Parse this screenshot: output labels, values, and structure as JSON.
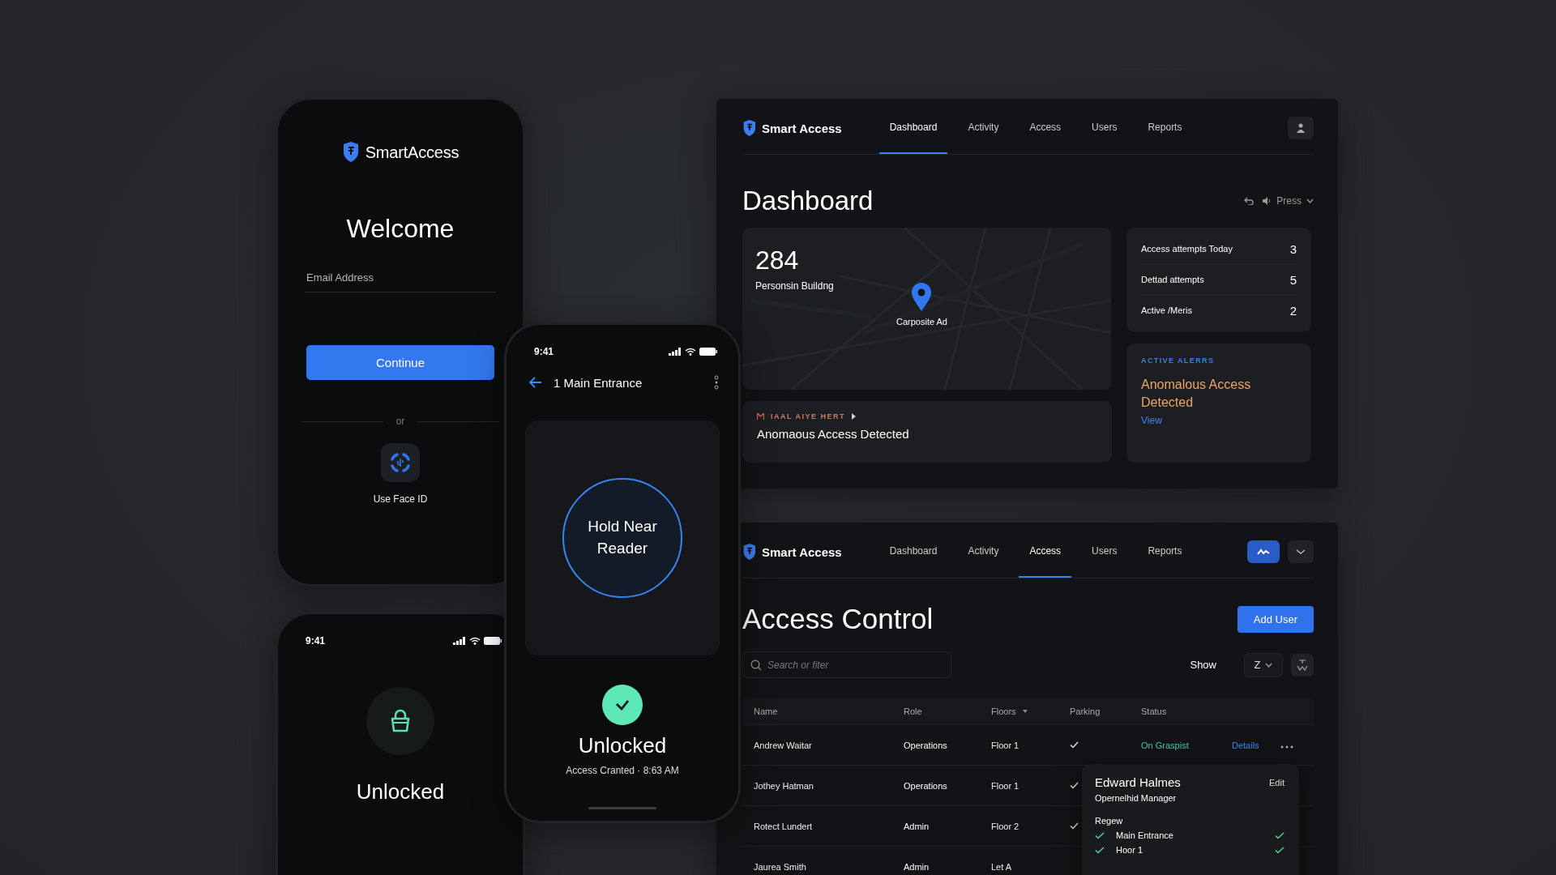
{
  "login_phone": {
    "brand": "SmartAccess",
    "title": "Welcome",
    "email": {
      "placeholder": "Email Address"
    },
    "continue_button": "Continue",
    "divider": "or",
    "face_id": "Use Face ID"
  },
  "reader_phone": {
    "status_bar": {
      "time": "9:41"
    },
    "title": "1 Main Entrance",
    "reader_prompt": "Hold Near Reader",
    "result": {
      "title": "Unlocked",
      "detail": "Access Cranted · 8:63 AM"
    }
  },
  "unlocked_phone": {
    "status_bar": {
      "time": "9:41"
    },
    "title": "Unlocked"
  },
  "dashboard": {
    "brand": "Smart Access",
    "tabs": [
      {
        "label": "Dashboard",
        "selected": true
      },
      {
        "label": "Activity",
        "selected": false
      },
      {
        "label": "Access",
        "selected": false
      },
      {
        "label": "Users",
        "selected": false
      },
      {
        "label": "Reports",
        "selected": false
      }
    ],
    "title": "Dashboard",
    "filter": "Press",
    "count": "284",
    "count_label": "Personsin Buildng",
    "map_pin_label": "Carposite Ad",
    "alert_banner": {
      "label": "IAAL AIYE HERT",
      "message": "Anomaous Access Detected"
    },
    "stats": [
      {
        "label": "Access attempts Today",
        "value": "3"
      },
      {
        "label": "Dettad attempts",
        "value": "5"
      },
      {
        "label": "Active /Meris",
        "value": "2"
      }
    ],
    "active_alerts": {
      "heading": "ACTIVE ALERRS",
      "message": "Anomalous Access Detected",
      "link": "View"
    }
  },
  "access_control": {
    "brand": "Smart Access",
    "tabs": [
      {
        "label": "Dashboard",
        "selected": false
      },
      {
        "label": "Activity",
        "selected": false
      },
      {
        "label": "Access",
        "selected": true
      },
      {
        "label": "Users",
        "selected": false
      },
      {
        "label": "Reports",
        "selected": false
      }
    ],
    "title": "Access Control",
    "add_button": "Add User",
    "search": {
      "placeholder": "Search or fiter"
    },
    "show_label": "Show",
    "show_value": "Z",
    "table": {
      "columns": [
        "Name",
        "Role",
        "Floors",
        "Parking",
        "Status"
      ],
      "rows": [
        {
          "name": "Andrew Waitar",
          "role": "Operations",
          "floors": "Floor 1",
          "parking": true,
          "status": "On Graspist",
          "details": "Details"
        },
        {
          "name": "Jothey Hatman",
          "role": "Operations",
          "floors": "Floor 1",
          "parking": true
        },
        {
          "name": "Rotect Lundert",
          "role": "Admin",
          "floors": "Floor 2",
          "parking": true
        },
        {
          "name": "Jaurea Smith",
          "role": "Admin",
          "floors": "Let A",
          "parking": false
        }
      ]
    },
    "popup": {
      "name": "Edward Halmes",
      "role": "Opernelhid Manager",
      "edit": "Edit",
      "section": "Regew",
      "items": [
        {
          "label": "Main Entrance",
          "checked": true
        },
        {
          "label": "Hoor 1",
          "checked": true
        }
      ]
    }
  }
}
